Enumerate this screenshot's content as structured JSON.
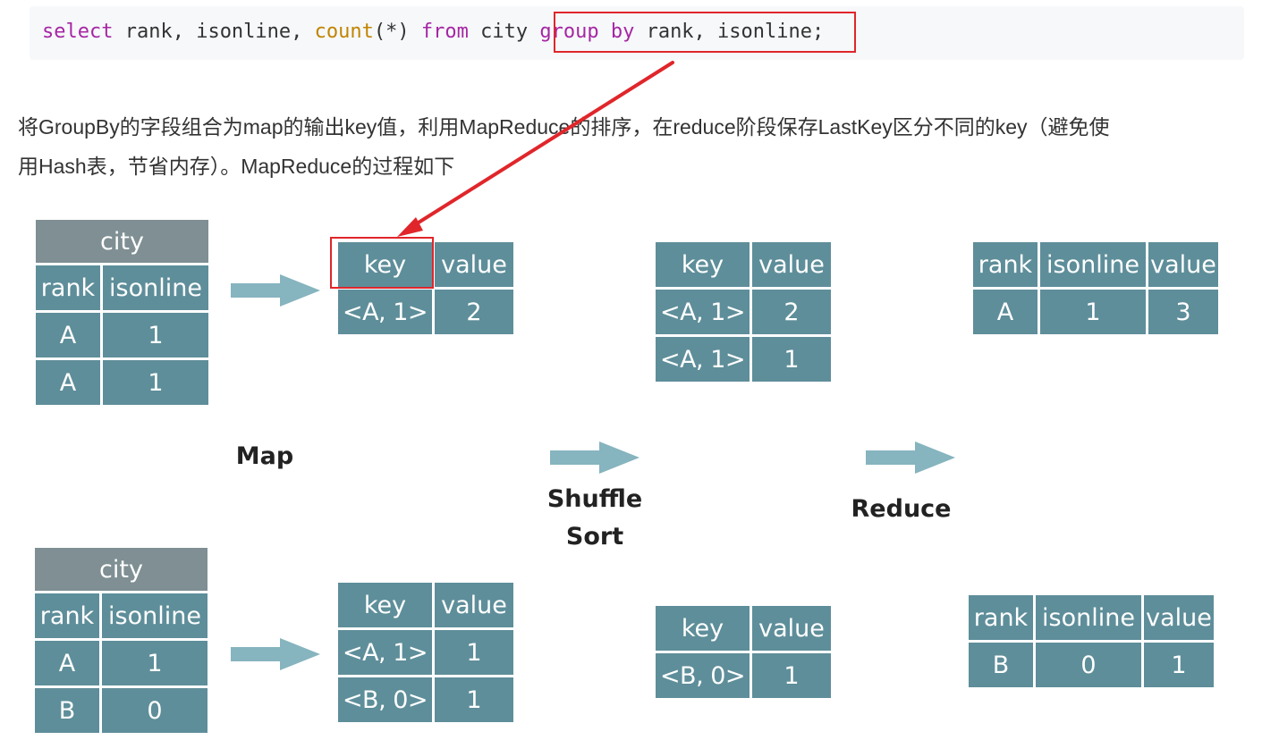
{
  "code": {
    "kw_select": "select",
    "t1": " rank, isonline, ",
    "fn_count": "count",
    "t2": "(*) ",
    "kw_from": "from",
    "t3": " city ",
    "kw_group": "group",
    "t4": " ",
    "kw_by": "by",
    "t5": " rank, isonline;"
  },
  "paragraph": {
    "line1": "将GroupBy的字段组合为map的输出key值，利用MapReduce的排序，在reduce阶段保存LastKey区分不同的key（避免使",
    "line2": "用Hash表，节省内存）。MapReduce的过程如下"
  },
  "stages": {
    "map": "Map",
    "shuffle": "Shuffle",
    "sort": "Sort",
    "reduce": "Reduce"
  },
  "input_top": {
    "title": "city",
    "headers": [
      "rank",
      "isonline"
    ],
    "rows": [
      [
        "A",
        "1"
      ],
      [
        "A",
        "1"
      ]
    ]
  },
  "input_bottom": {
    "title": "city",
    "headers": [
      "rank",
      "isonline"
    ],
    "rows": [
      [
        "A",
        "1"
      ],
      [
        "B",
        "0"
      ]
    ]
  },
  "map_top": {
    "headers": [
      "key",
      "value"
    ],
    "rows": [
      [
        "<A, 1>",
        "2"
      ]
    ]
  },
  "map_bottom": {
    "headers": [
      "key",
      "value"
    ],
    "rows": [
      [
        "<A, 1>",
        "1"
      ],
      [
        "<B, 0>",
        "1"
      ]
    ]
  },
  "shuffle_top": {
    "headers": [
      "key",
      "value"
    ],
    "rows": [
      [
        "<A, 1>",
        "2"
      ],
      [
        "<A, 1>",
        "1"
      ]
    ]
  },
  "shuffle_bottom": {
    "headers": [
      "key",
      "value"
    ],
    "rows": [
      [
        "<B, 0>",
        "1"
      ]
    ]
  },
  "reduce_top": {
    "headers": [
      "rank",
      "isonline",
      "value"
    ],
    "rows": [
      [
        "A",
        "1",
        "3"
      ]
    ]
  },
  "reduce_bottom": {
    "headers": [
      "rank",
      "isonline",
      "value"
    ],
    "rows": [
      [
        "B",
        "0",
        "1"
      ]
    ]
  },
  "colors": {
    "cell": "#5e8e9a",
    "title_cell": "#7f8f93",
    "flow_arrow": "#86b4bf",
    "highlight": "#e0262b"
  }
}
